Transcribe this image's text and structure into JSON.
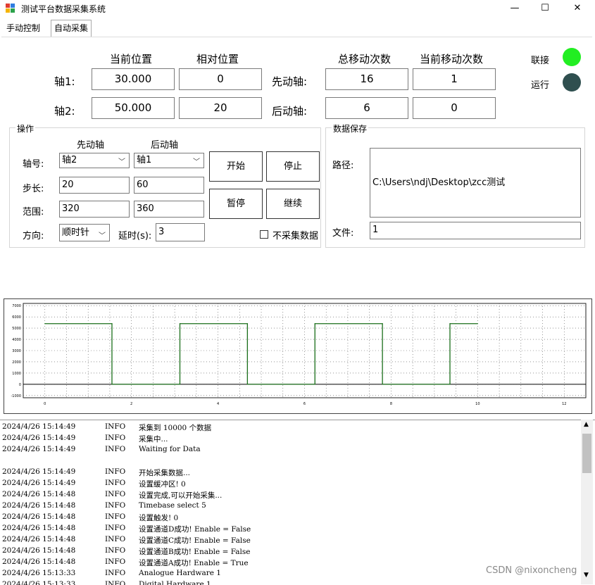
{
  "window": {
    "title": "测试平台数据采集系统",
    "minimize": "—",
    "maximize": "☐",
    "close": "✕"
  },
  "tabs": [
    "手动控制",
    "自动采集"
  ],
  "headers": {
    "current_pos": "当前位置",
    "relative_pos": "相对位置",
    "total_moves": "总移动次数",
    "current_moves": "当前移动次数"
  },
  "axis1": {
    "label": "轴1:",
    "current": "30.000",
    "relative": "0"
  },
  "axis2": {
    "label": "轴2:",
    "current": "50.000",
    "relative": "20"
  },
  "lead_axis": {
    "label": "先动轴:",
    "total": "16",
    "current": "1"
  },
  "follow_axis": {
    "label": "后动轴:",
    "total": "6",
    "current": "0"
  },
  "status": {
    "connect_label": "联接",
    "connect_color": "#22ee22",
    "run_label": "运行",
    "run_color": "#2f4f4f"
  },
  "operation": {
    "title": "操作",
    "col_lead": "先动轴",
    "col_follow": "后动轴",
    "axis_no_label": "轴号:",
    "axis_no_lead": "轴2",
    "axis_no_follow": "轴1",
    "step_label": "步长:",
    "step_lead": "20",
    "step_follow": "60",
    "range_label": "范围:",
    "range_lead": "320",
    "range_follow": "360",
    "direction_label": "方向:",
    "direction": "顺时针",
    "delay_label": "延时(s):",
    "delay": "3",
    "start": "开始",
    "stop": "停止",
    "pause": "暂停",
    "resume": "继续",
    "no_collect": "不采集数据"
  },
  "save": {
    "title": "数据保存",
    "path_label": "路径:",
    "path": "C:\\Users\\ndj\\Desktop\\zcc测试",
    "file_label": "文件:",
    "file": "1"
  },
  "chart_data": {
    "type": "line",
    "title": "",
    "xlabel": "",
    "ylabel": "",
    "xlim": [
      -0.5,
      12.5
    ],
    "ylim": [
      -1200,
      7200
    ],
    "xticks": [
      "0",
      "2",
      "4",
      "6",
      "8",
      "10",
      "12"
    ],
    "yticks": [
      "-1000",
      "0",
      "1000",
      "2000",
      "3000",
      "4000",
      "5000",
      "6000",
      "7000"
    ],
    "grid": true,
    "series": [
      {
        "name": "",
        "color": "#1a6e1a",
        "x": [
          0,
          1.55,
          1.55,
          3.12,
          3.12,
          4.68,
          4.68,
          6.24,
          6.24,
          7.8,
          7.8,
          9.36,
          9.36,
          10.0
        ],
        "y": [
          5400,
          5400,
          0,
          0,
          5400,
          5400,
          0,
          0,
          5400,
          5400,
          0,
          0,
          5400,
          5400
        ]
      }
    ]
  },
  "log": [
    [
      "2024/4/26 15:14:49",
      "INFO",
      "采集到 10000 个数据"
    ],
    [
      "2024/4/26 15:14:49",
      "INFO",
      "采集中..."
    ],
    [
      "2024/4/26 15:14:49",
      "INFO",
      "Waiting for Data"
    ],
    [
      "",
      "",
      ""
    ],
    [
      "2024/4/26 15:14:49",
      "INFO",
      "开始采集数据..."
    ],
    [
      "2024/4/26 15:14:49",
      "INFO",
      "设置缓冲区! 0"
    ],
    [
      "2024/4/26 15:14:48",
      "INFO",
      "设置完成,可以开始采集..."
    ],
    [
      "2024/4/26 15:14:48",
      "INFO",
      "Timebase select 5"
    ],
    [
      "2024/4/26 15:14:48",
      "INFO",
      "设置触发! 0"
    ],
    [
      "2024/4/26 15:14:48",
      "INFO",
      "设置通道D成功! Enable = False"
    ],
    [
      "2024/4/26 15:14:48",
      "INFO",
      "设置通道C成功! Enable = False"
    ],
    [
      "2024/4/26 15:14:48",
      "INFO",
      "设置通道B成功! Enable = False"
    ],
    [
      "2024/4/26 15:14:48",
      "INFO",
      "设置通道A成功! Enable = True"
    ],
    [
      "2024/4/26 15:13:33",
      "INFO",
      "Analogue Hardware 1"
    ],
    [
      "2024/4/26 15:13:33",
      "INFO",
      "Digital Hardware 1"
    ]
  ],
  "watermark": "CSDN @nixoncheng"
}
